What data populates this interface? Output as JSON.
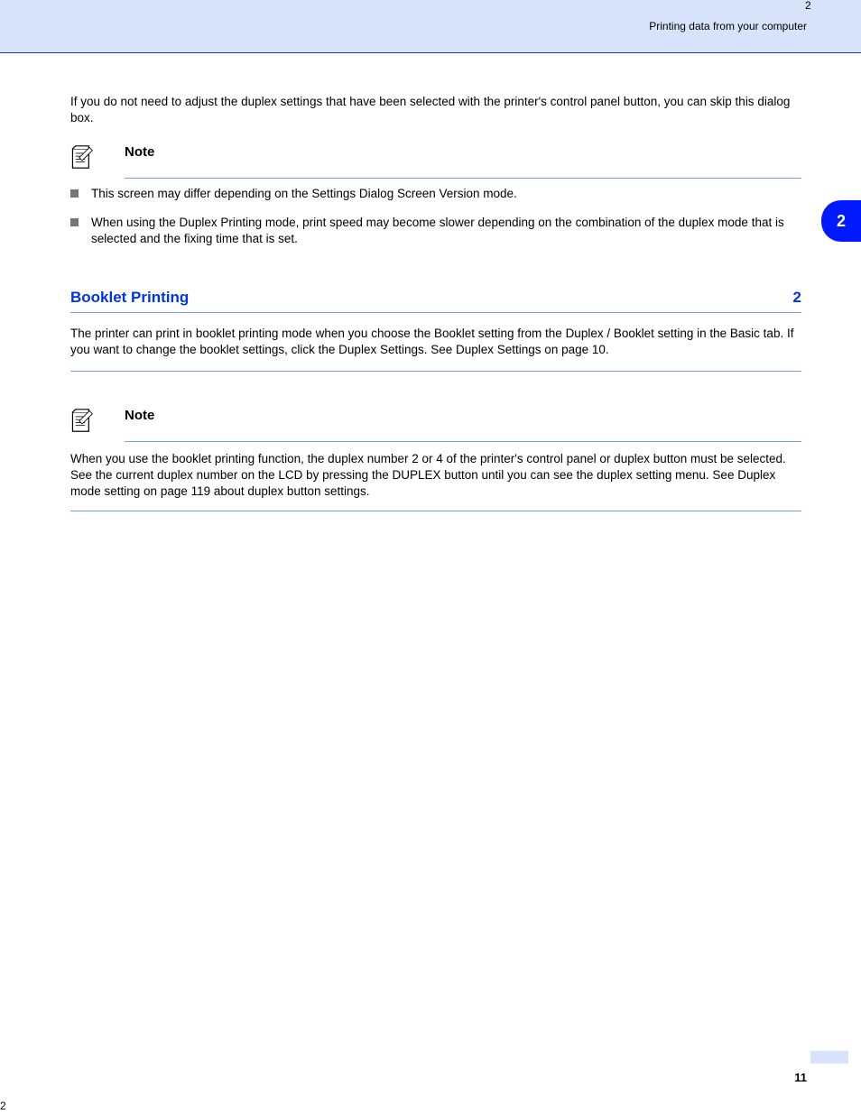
{
  "header": {
    "text": "Printing data from your computer"
  },
  "aux_top": "2",
  "aux_bottom": "2",
  "sidetab": "2",
  "pagenum": "11",
  "block_intro": "If you do not need to adjust the duplex settings that have been selected with the printer's control panel button, you can skip this dialog box.",
  "note1": {
    "label": "Note",
    "bullets": [
      "This screen may differ depending on the Settings Dialog Screen Version mode.",
      "When using the Duplex Printing mode, print speed may become slower depending on the combination of the duplex mode that is selected and the fixing time that is set."
    ]
  },
  "section": {
    "heading": "Booklet Printing",
    "num": "2",
    "body": "The printer can print in booklet printing mode when you choose the Booklet setting from the Duplex / Booklet setting in the Basic tab. If you want to change the booklet settings, click the Duplex Settings. See Duplex Settings on page 10."
  },
  "note2": {
    "label": "Note",
    "body": "When you use the booklet printing function, the duplex number 2 or 4 of the printer's control panel or duplex button must be selected. See the current duplex number on the LCD by pressing the DUPLEX button until you can see the duplex setting menu. See Duplex mode setting on page 119 about duplex button settings."
  }
}
